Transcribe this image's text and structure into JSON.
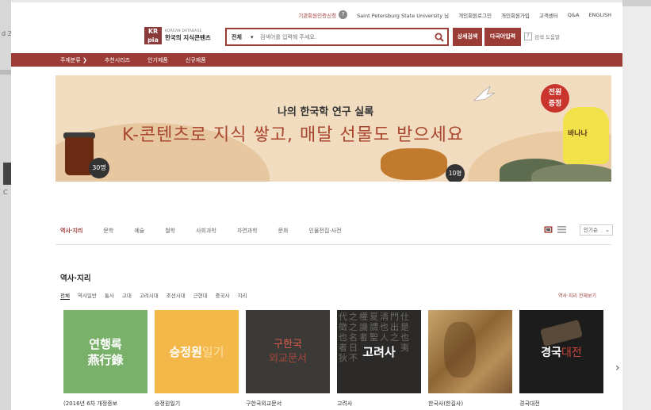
{
  "util_links": {
    "institution_auth": "기관회원인증신청",
    "help_q": "?",
    "user_name": "Saint Petersburg State University 님",
    "personal_login": "개인회원로그인",
    "personal_join": "개인회원가입",
    "customer_center": "고객센터",
    "qa": "Q&A",
    "english": "ENGLISH"
  },
  "logo": {
    "mark": "KRpia",
    "small": "KOREAN DATABASE",
    "big": "한국의 지식콘텐츠"
  },
  "search": {
    "scope": "전체",
    "placeholder": "검색어를 입력해 주세요.",
    "detail_button": "상세검색",
    "multi_button": "다국어입력",
    "help": "검색 도움말",
    "help_box": "?"
  },
  "nav": {
    "items": [
      "주제분류 ❯",
      "추천시리즈",
      "인기제품",
      "신규제품"
    ]
  },
  "banner": {
    "sub": "나의 한국학 연구 실록",
    "headline": "K-콘텐츠로 지식 쌓고, 매달 선물도 받으세요",
    "coffee_count": "30명",
    "chicken_count": "10명",
    "gift_label": "전원\n증정",
    "milk_label": "바나나"
  },
  "tabs": {
    "items": [
      "역사·지리",
      "문학",
      "예술",
      "철학",
      "사회과학",
      "자연과학",
      "문화",
      "인물전집·사전"
    ],
    "active": 0
  },
  "sort": {
    "value": "인기순"
  },
  "section": {
    "title": "역사·지리",
    "subtabs": [
      "전체",
      "역사일반",
      "통사",
      "고대",
      "고려시대",
      "조선시대",
      "근현대",
      "중국사",
      "지리"
    ],
    "view_all": "역사·지리 전체보기"
  },
  "cards": [
    {
      "thumb_l1": "연행록",
      "thumb_l2": "燕行錄",
      "caption": "(2016년 6차 개정증보"
    },
    {
      "thumb_main": "승정원",
      "thumb_accent": "일기",
      "caption": "승정원일기"
    },
    {
      "thumb_l1": "구한국",
      "thumb_l2": "외교문서",
      "caption": "구한국외교문서"
    },
    {
      "thumb_bg": "代之權夏淸門仕徵之譏謂也出是也名者聖人之也者日凡三皇帝夷狄不五大之謂",
      "thumb_main": "고려사",
      "caption": "고려사"
    },
    {
      "caption": "한국사(한길사)"
    },
    {
      "thumb_main": "경국",
      "thumb_accent": "대전",
      "caption": "경국대전"
    }
  ],
  "colors": {
    "brand": "#9c3c36",
    "nav_bg": "#9c3c36"
  }
}
